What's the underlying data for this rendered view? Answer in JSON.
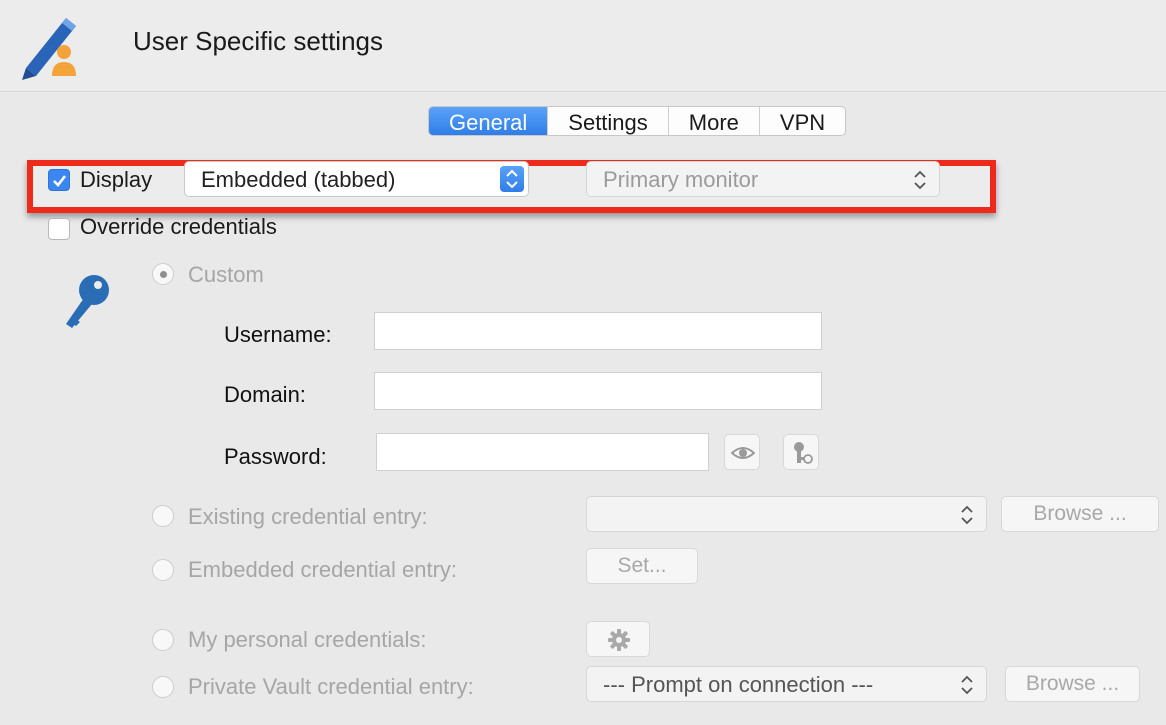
{
  "window": {
    "title": "User Specific settings"
  },
  "icons": {
    "app": "pen-user-icon",
    "key": "key-icon",
    "eye": "eye-icon",
    "key_gen": "key-generate-icon",
    "gear": "gear-icon"
  },
  "tabs": [
    {
      "label": "General",
      "active": true
    },
    {
      "label": "Settings",
      "active": false
    },
    {
      "label": "More",
      "active": false
    },
    {
      "label": "VPN",
      "active": false
    }
  ],
  "display": {
    "checkbox_label": "Display",
    "checked": true,
    "mode_value": "Embedded (tabbed)",
    "monitor_value": "Primary monitor"
  },
  "override": {
    "label": "Override credentials",
    "checked": false
  },
  "custom": {
    "radio_label": "Custom",
    "username_label": "Username:",
    "username_value": "",
    "domain_label": "Domain:",
    "domain_value": "",
    "password_label": "Password:",
    "password_value": ""
  },
  "existing": {
    "label": "Existing credential entry:",
    "value": "",
    "browse_label": "Browse ..."
  },
  "embedded": {
    "label": "Embedded credential entry:",
    "set_label": "Set..."
  },
  "personal": {
    "label": "My personal credentials:"
  },
  "vault": {
    "label": "Private Vault credential entry:",
    "value": "--- Prompt on connection ---",
    "browse_label": "Browse ..."
  },
  "colors": {
    "accent": "#2f7ee8",
    "highlight": "#ee2a1a",
    "key_icon": "#2a6db5"
  }
}
